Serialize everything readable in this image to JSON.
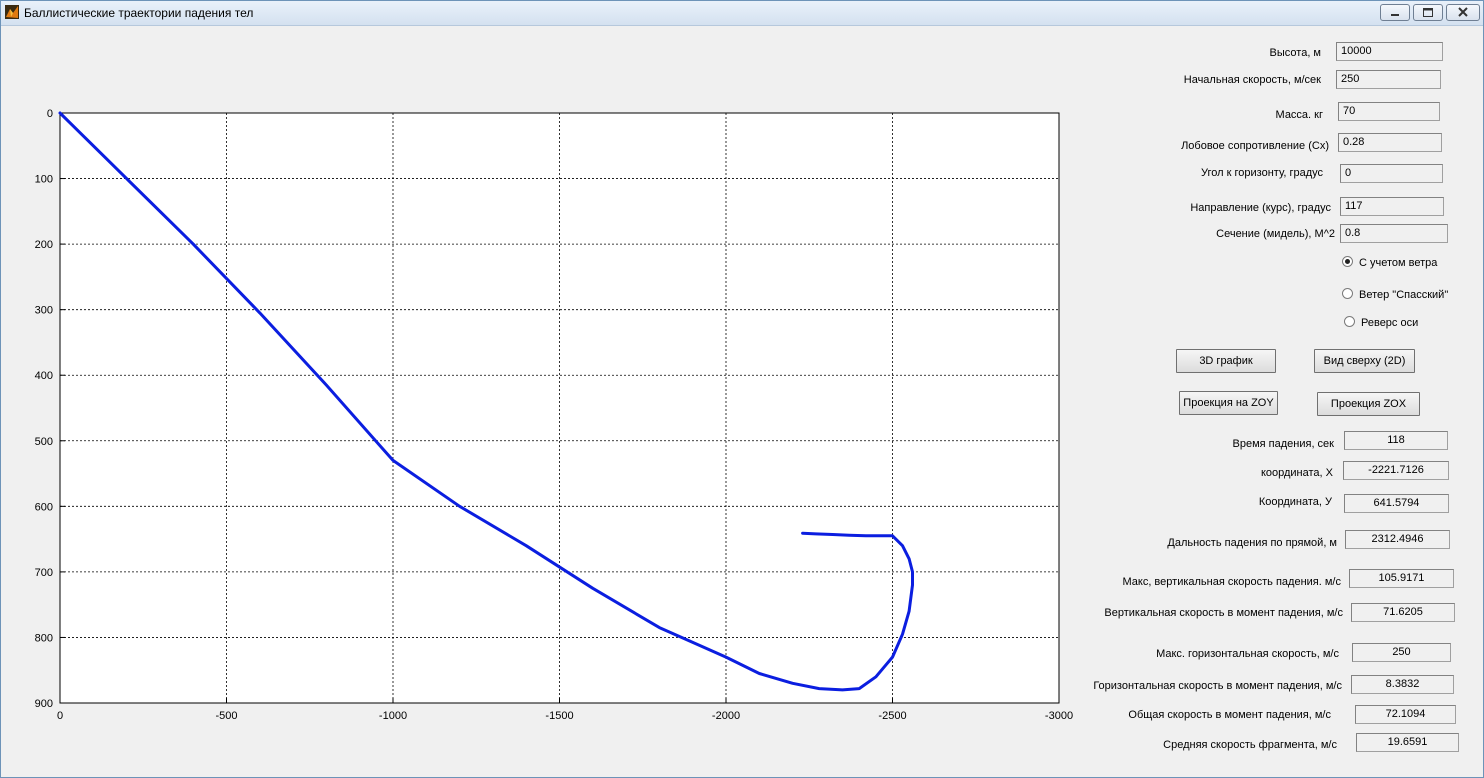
{
  "window": {
    "title": "Баллистические траектории падения тел"
  },
  "inputs": [
    {
      "label": "Высота, м",
      "value": "10000"
    },
    {
      "label": "Начальная скорость, м/сек",
      "value": "250"
    },
    {
      "label": "Масса. кг",
      "value": "70"
    },
    {
      "label": "Лобовое сопротивление (Cx)",
      "value": "0.28"
    },
    {
      "label": "Угол к горизонту, градус",
      "value": "0"
    },
    {
      "label": "Направление  (курс), градус",
      "value": "117"
    },
    {
      "label": "Сечение (мидель), М^2",
      "value": "0.8"
    }
  ],
  "options": [
    {
      "label": "С учетом ветра",
      "checked": true
    },
    {
      "label": "Ветер \"Спасский\"",
      "checked": false
    },
    {
      "label": "Реверс оси",
      "checked": false
    }
  ],
  "buttons": {
    "graph3d": "3D график",
    "top_view": "Вид сверху (2D)",
    "proj_zoy": "Проекция на ZOY",
    "proj_zox": "Проекция ZOX"
  },
  "results": [
    {
      "label": "Время падения, сек",
      "value": "118"
    },
    {
      "label": "координата, Х",
      "value": "-2221.7126"
    },
    {
      "label": "Координата, У",
      "value": "641.5794"
    },
    {
      "label": "Дальность падения по прямой, м",
      "value": "2312.4946"
    },
    {
      "label": "Макс,  вертикальная скорость падения. м/с",
      "value": "105.9171"
    },
    {
      "label": "Вертикальная  скорость в момент падения, м/с",
      "value": "71.6205"
    },
    {
      "label": "Макс. горизонтальная скорость, м/с",
      "value": "250"
    },
    {
      "label": "Горизонтальная скорость в момент падения, м/с",
      "value": "8.3832"
    },
    {
      "label": "Общая скорость в момент падения, м/с",
      "value": "72.1094"
    },
    {
      "label": "Средняя скорость фрагмента, м/с",
      "value": "19.6591"
    }
  ],
  "chart_data": {
    "type": "line",
    "title": "",
    "xlabel": "",
    "ylabel": "",
    "xlim": [
      0,
      -3000
    ],
    "ylim": [
      0,
      900
    ],
    "y_reversed": true,
    "grid": true,
    "x_ticks": [
      "0",
      "-500",
      "-1000",
      "-1500",
      "-2000",
      "-2500",
      "-3000"
    ],
    "y_ticks": [
      "0",
      "100",
      "200",
      "300",
      "400",
      "500",
      "600",
      "700",
      "800",
      "900"
    ],
    "series": [
      {
        "color": "#0b1ee0",
        "x": [
          0,
          -200,
          -400,
          -600,
          -800,
          -1000,
          -1200,
          -1400,
          -1600,
          -1800,
          -2000,
          -2100,
          -2200,
          -2280,
          -2350,
          -2400,
          -2450,
          -2500,
          -2530,
          -2550,
          -2560,
          -2560,
          -2550,
          -2530,
          -2500,
          -2460,
          -2420,
          -2370,
          -2320,
          -2270,
          -2230
        ],
        "y": [
          0,
          100,
          200,
          305,
          415,
          530,
          600,
          660,
          725,
          785,
          830,
          855,
          870,
          878,
          880,
          878,
          860,
          830,
          795,
          760,
          720,
          700,
          680,
          660,
          645,
          645,
          645,
          644,
          643,
          642,
          641
        ]
      }
    ]
  }
}
